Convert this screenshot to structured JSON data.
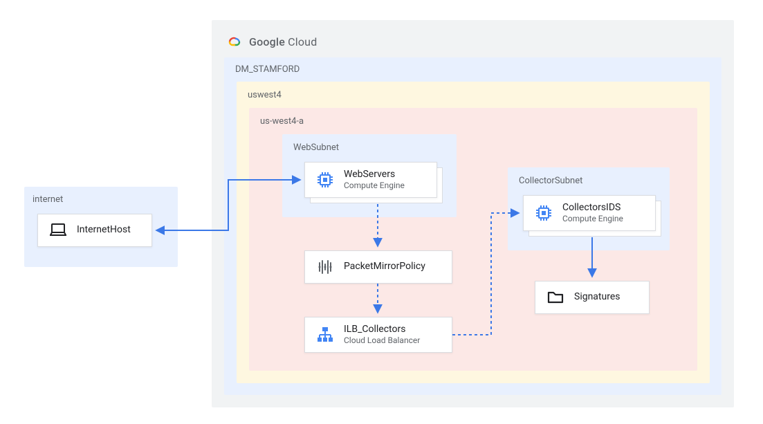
{
  "cloud_provider": {
    "bold": "Google",
    "light": "Cloud"
  },
  "containers": {
    "internet": "internet",
    "project": "DM_STAMFORD",
    "region": "uswest4",
    "zone": "us-west4-a",
    "websubnet": "WebSubnet",
    "collectorsubnet": "CollectorSubnet"
  },
  "nodes": {
    "internet_host": {
      "title": "InternetHost"
    },
    "webservers": {
      "title": "WebServers",
      "sub": "Compute Engine"
    },
    "packet_mirror": {
      "title": "PacketMirrorPolicy"
    },
    "ilb": {
      "title": "ILB_Collectors",
      "sub": "Cloud Load Balancer"
    },
    "collectors_ids": {
      "title": "CollectorsIDS",
      "sub": "Compute Engine"
    },
    "signatures": {
      "title": "Signatures"
    }
  },
  "colors": {
    "arrow": "#3b78e7",
    "internet_bg": "#e8f0fe",
    "project_bg": "#e8f0fe",
    "region_bg": "#fef7e0",
    "zone_bg": "#fce8e6",
    "websubnet_bg": "#e8f0fe",
    "collectorsubnet_bg": "#e8f0fe",
    "outer_bg": "#f1f3f4"
  }
}
